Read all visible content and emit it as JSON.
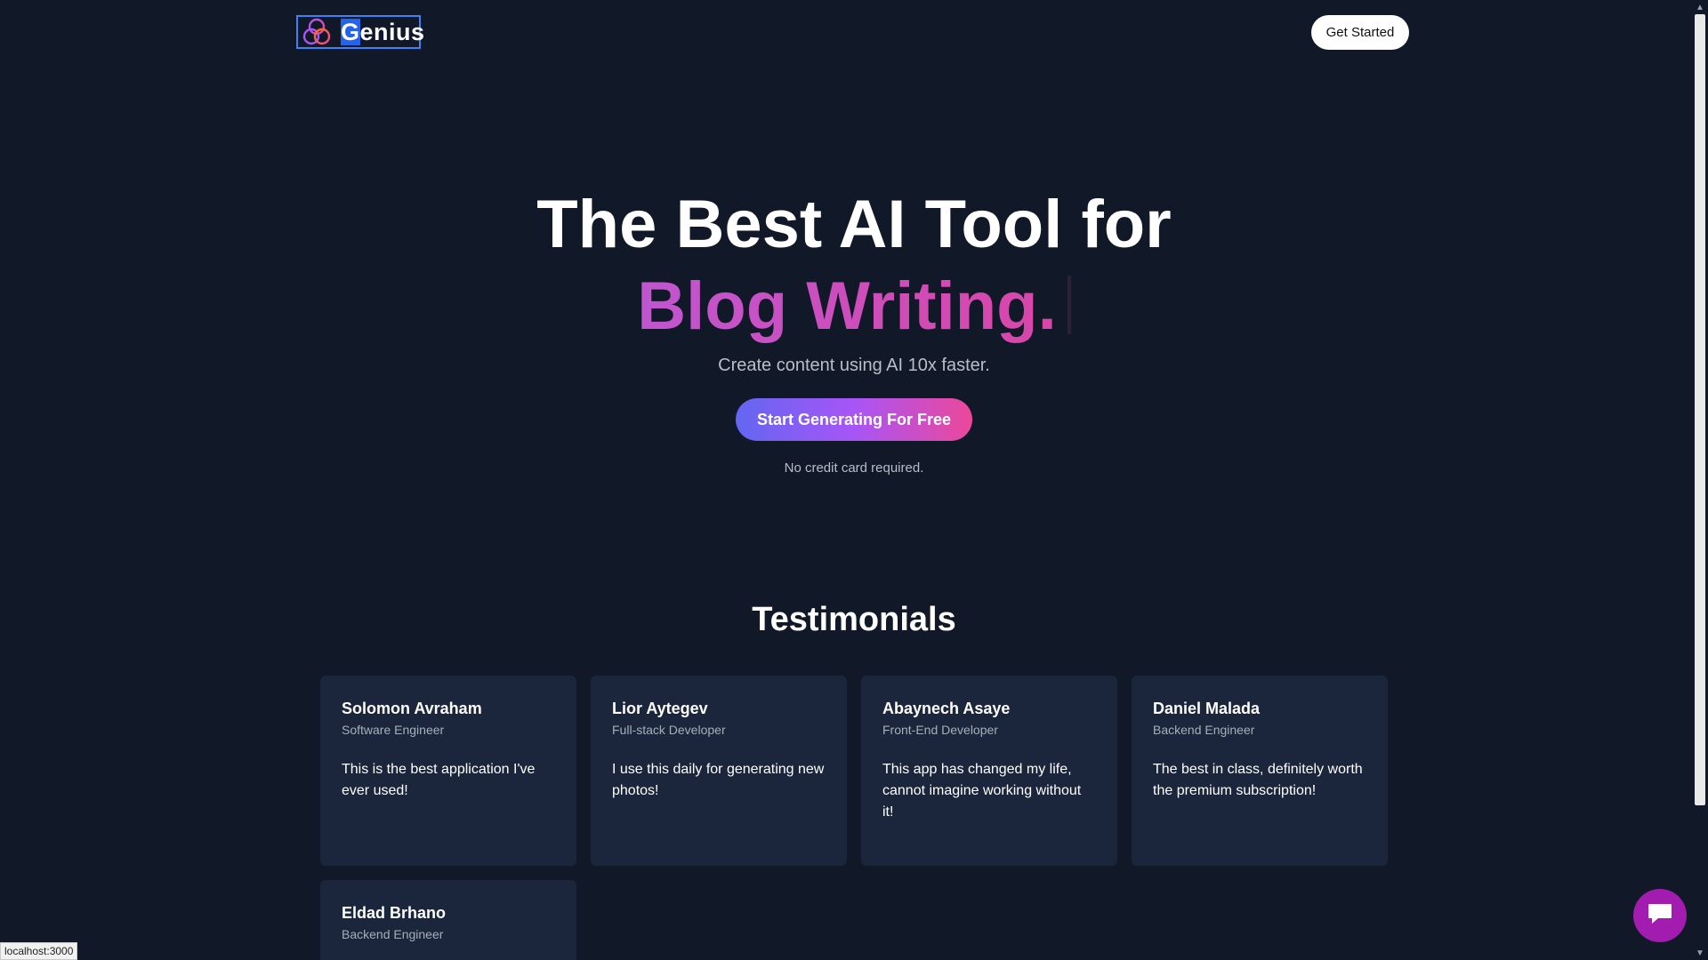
{
  "header": {
    "logo_first_letter": "G",
    "logo_rest": "enius",
    "get_started_label": "Get Started"
  },
  "hero": {
    "title_line": "The Best AI Tool for",
    "typed_text": "Blog Writing.",
    "subtitle": "Create content using AI 10x faster.",
    "cta_label": "Start Generating For Free",
    "note": "No credit card required."
  },
  "testimonials": {
    "title": "Testimonials",
    "items": [
      {
        "name": "Solomon Avraham",
        "role": "Software Engineer",
        "quote": "This is the best application I've ever used!"
      },
      {
        "name": "Lior Aytegev",
        "role": "Full-stack Developer",
        "quote": "I use this daily for generating new photos!"
      },
      {
        "name": "Abaynech Asaye",
        "role": "Front-End Developer",
        "quote": "This app has changed my life, cannot imagine working without it!"
      },
      {
        "name": "Daniel Malada",
        "role": "Backend Engineer",
        "quote": "The best in class, definitely worth the premium subscription!"
      },
      {
        "name": "Eldad Brhano",
        "role": "Backend Engineer",
        "quote": ""
      }
    ]
  },
  "status_bar": {
    "url": "localhost:3000"
  },
  "icons": {
    "logo": "three-rings-logo-icon",
    "chat": "chat-bubble-icon",
    "scroll_up": "chevron-up-icon",
    "scroll_down": "chevron-down-icon"
  },
  "colors": {
    "background": "#111827",
    "card": "#1b253b",
    "accent_gradient_start": "#6366f1",
    "accent_gradient_mid": "#a855f7",
    "accent_gradient_end": "#ec4899",
    "typed_text": "#c956c7",
    "chat_button": "#a21caf",
    "logo_selection": "#2563eb"
  }
}
